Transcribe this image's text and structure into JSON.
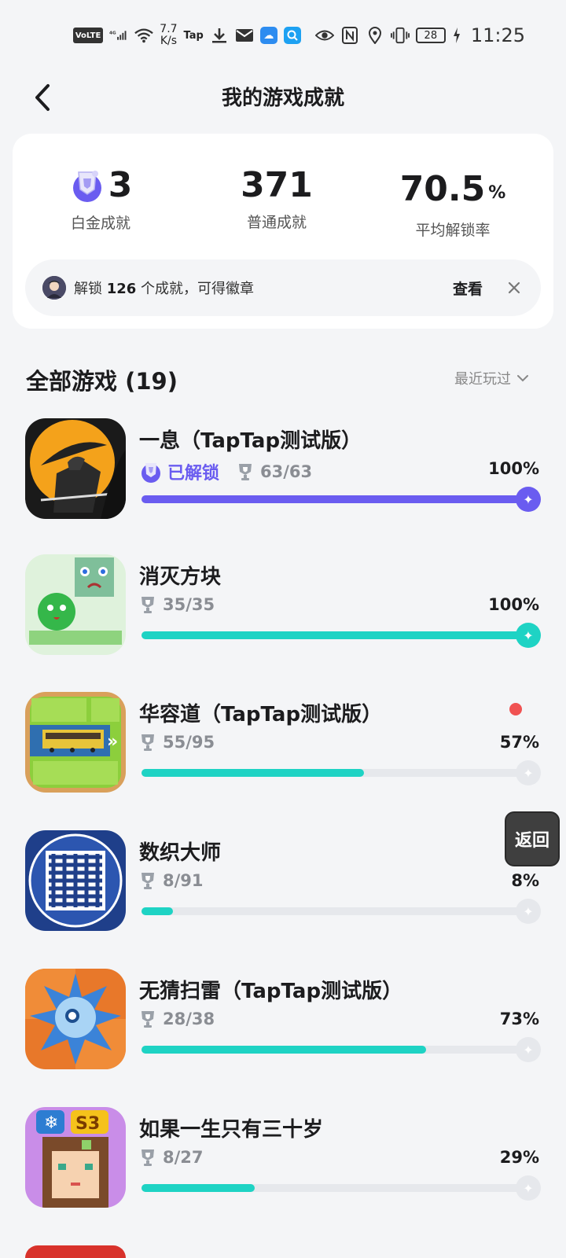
{
  "status_bar": {
    "volte": "VoLTE",
    "network": "4G",
    "speed_value": "7.7",
    "speed_unit": "K/s",
    "tap_label": "Tap",
    "battery": "28",
    "time": "11:25"
  },
  "header": {
    "title": "我的游戏成就"
  },
  "summary": {
    "platinum": {
      "value": "3",
      "label": "白金成就"
    },
    "normal": {
      "value": "371",
      "label": "普通成就"
    },
    "rate": {
      "value": "70.5",
      "unit": "%",
      "label": "平均解锁率"
    },
    "banner": {
      "prefix": "解锁 ",
      "count": "126",
      "suffix": " 个成就，可得徽章",
      "view_label": "查看"
    }
  },
  "section": {
    "title": "全部游戏 (19)",
    "sort_label": "最近玩过"
  },
  "games": [
    {
      "name": "一息（TapTap测试版）",
      "unlocked_label": "已解锁",
      "progress_text": "63/63",
      "percent": "100%",
      "fraction": 1.0,
      "color": "#6a5cf0"
    },
    {
      "name": "消灭方块",
      "progress_text": "35/35",
      "percent": "100%",
      "fraction": 1.0,
      "color": "#1ed3c4"
    },
    {
      "name": "华容道（TapTap测试版）",
      "progress_text": "55/95",
      "percent": "57%",
      "fraction": 0.57,
      "color": "#1ed3c4"
    },
    {
      "name": "数织大师",
      "progress_text": "8/91",
      "percent": "8%",
      "fraction": 0.08,
      "color": "#1ed3c4"
    },
    {
      "name": "无猜扫雷（TapTap测试版）",
      "progress_text": "28/38",
      "percent": "73%",
      "fraction": 0.73,
      "color": "#1ed3c4"
    },
    {
      "name": "如果一生只有三十岁",
      "progress_text": "8/27",
      "percent": "29%",
      "fraction": 0.29,
      "color": "#1ed3c4"
    }
  ],
  "floating": {
    "back_label": "返回"
  },
  "colors": {
    "accent_purple": "#6a5cf0",
    "accent_teal": "#1ed3c4",
    "track": "#e6e8ec",
    "background": "#f4f5f7"
  }
}
